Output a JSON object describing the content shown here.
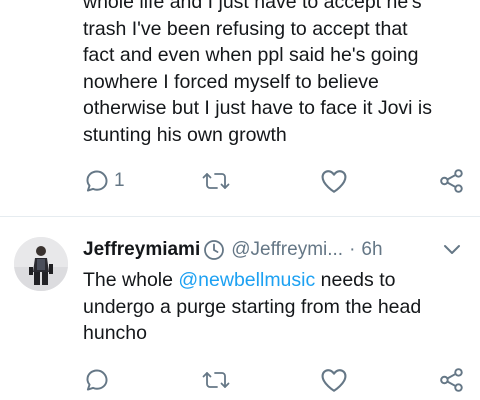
{
  "tweet_prev": {
    "lines": [
      "whole life and I just have to accept he's",
      "trash I've been refusing to accept that",
      "fact and even when ppl said he's going",
      "nowhere I forced myself to believe",
      "otherwise but I just have to face it Jovi is",
      "stunting his own growth"
    ],
    "reply_count": "1"
  },
  "tweet_main": {
    "display_name": "Jeffreymiami",
    "handle": "@Jeffreymi...",
    "separator": "·",
    "time": "6h",
    "line1_before": "The whole ",
    "mention": "@newbellmusic",
    "line1_after": " needs to",
    "line2": "undergo a purge starting from the head",
    "line3": "huncho"
  },
  "colors": {
    "text": "#14171a",
    "secondary": "#657786",
    "link": "#1da1f2",
    "divider": "#e6ecf0"
  },
  "icons": {
    "reply": "reply-icon",
    "retweet": "retweet-icon",
    "like": "like-icon",
    "share": "share-icon",
    "clock": "clock-icon",
    "caret": "chevron-down-icon"
  }
}
